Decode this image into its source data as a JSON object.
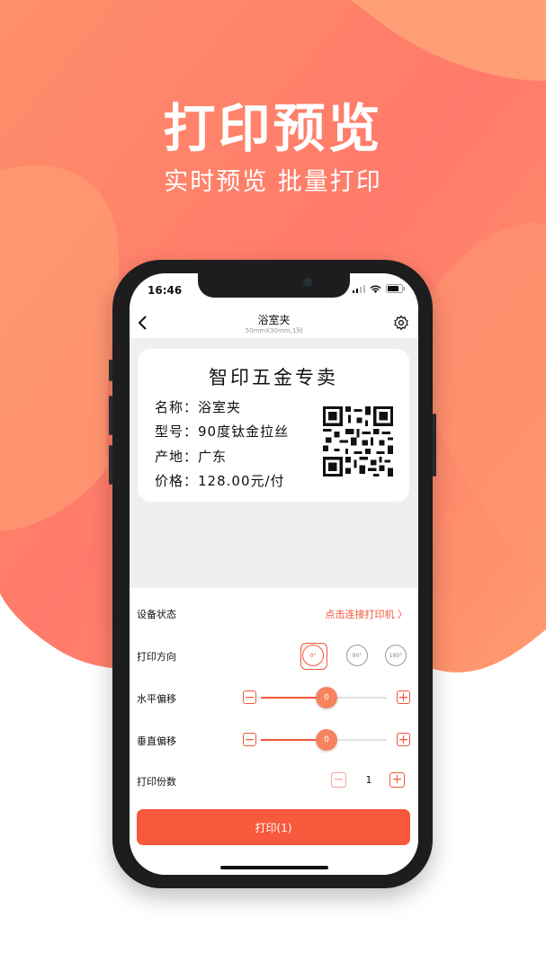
{
  "colors": {
    "accent": "#f2573a",
    "bg_gradient_start": "#ff6b6b",
    "bg_gradient_end": "#ffb27a",
    "button": "#f8583c"
  },
  "hero": {
    "title": "打印预览",
    "subtitle": "实时预览  批量打印"
  },
  "status": {
    "time": "16:46"
  },
  "nav": {
    "back_icon": "chevron-left-icon",
    "title": "浴室夹",
    "subtitle": "50mmX30mm,1列",
    "settings_icon": "gear-icon"
  },
  "label": {
    "title": "智印五金专卖",
    "rows": [
      "名称：浴室夹",
      "型号：90度钛金拉丝",
      "产地：广东",
      "价格：128.00元/付"
    ]
  },
  "settings": {
    "device_status_label": "设备状态",
    "connect_link": "点击连接打印机 〉",
    "orientation_label": "打印方向",
    "orientation_options": [
      "0°",
      "90°",
      "180°"
    ],
    "selected_orientation": "0°",
    "horizontal_offset_label": "水平偏移",
    "horizontal_offset_value": "0",
    "vertical_offset_label": "垂直偏移",
    "vertical_offset_value": "0",
    "copies_label": "打印份数",
    "copies_value": "1",
    "minus": "−",
    "plus": "+"
  },
  "print_button": "打印(1)"
}
